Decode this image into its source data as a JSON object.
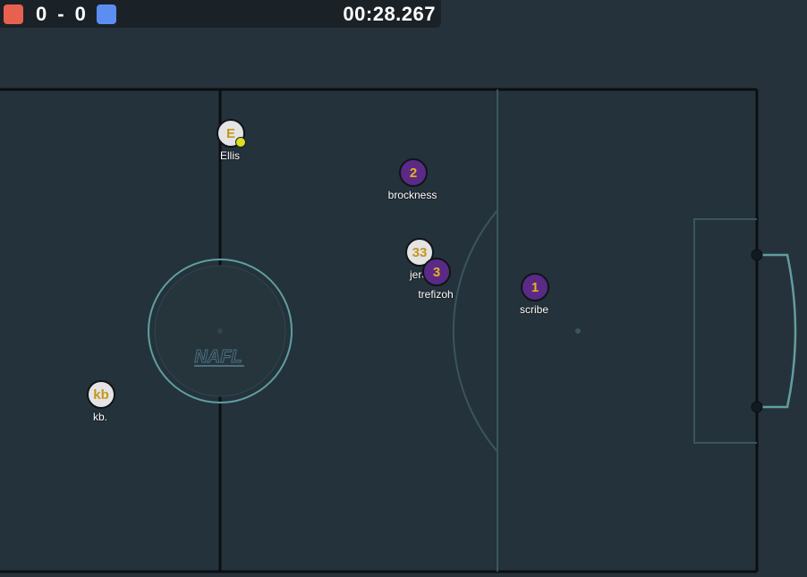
{
  "scoreboard": {
    "red_score": "0",
    "separator": "-",
    "blue_score": "0",
    "timer": "00:28.267",
    "red_color": "#e8604f",
    "blue_color": "#5b8ef0"
  },
  "pitch": {
    "logo_text": "NAFL",
    "line_color": "#0b0f12",
    "marking_color": "#5f9ea0"
  },
  "players": [
    {
      "id": "ellis",
      "label": "E",
      "name": "Ellis",
      "team": "red",
      "has_ball": true
    },
    {
      "id": "brockness",
      "label": "2",
      "name": "brockness",
      "team": "blue"
    },
    {
      "id": "jer",
      "label": "33",
      "name": "jer3",
      "team": "red"
    },
    {
      "id": "trefizoh",
      "label": "3",
      "name": "trefizoh",
      "team": "blue"
    },
    {
      "id": "scribe",
      "label": "1",
      "name": "scribe",
      "team": "blue"
    },
    {
      "id": "kb",
      "label": "kb",
      "name": "kb.",
      "team": "red"
    }
  ]
}
